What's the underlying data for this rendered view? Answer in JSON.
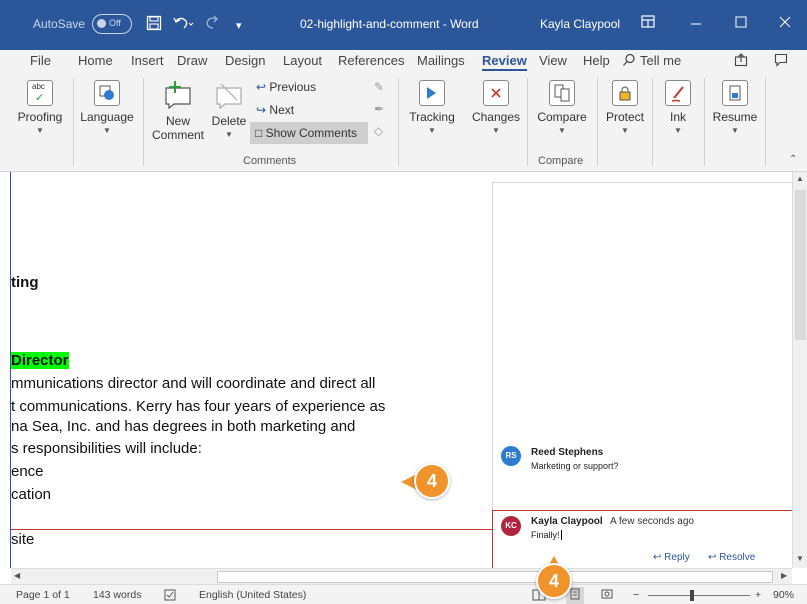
{
  "titlebar": {
    "autosave_label": "AutoSave",
    "autosave_state": "Off",
    "document_title": "02-highlight-and-comment - Word",
    "user_name": "Kayla Claypool",
    "quick_access_icons": [
      "save-icon",
      "undo-icon",
      "redo-icon",
      "customize-icon"
    ],
    "window_controls": [
      "ribbon-display-icon",
      "minimize-icon",
      "maximize-icon",
      "close-icon"
    ]
  },
  "tabs": {
    "items": [
      {
        "label": "File"
      },
      {
        "label": "Home"
      },
      {
        "label": "Insert"
      },
      {
        "label": "Draw"
      },
      {
        "label": "Design"
      },
      {
        "label": "Layout"
      },
      {
        "label": "References"
      },
      {
        "label": "Mailings"
      },
      {
        "label": "Review",
        "active": true
      },
      {
        "label": "View"
      },
      {
        "label": "Help"
      }
    ],
    "tell_me": "Tell me"
  },
  "ribbon": {
    "proofing": "Proofing",
    "language": "Language",
    "new_comment_line1": "New",
    "new_comment_line2": "Comment",
    "delete": "Delete",
    "previous": "Previous",
    "next": "Next",
    "show_comments": "Show Comments",
    "comments_group": "Comments",
    "tracking": "Tracking",
    "changes": "Changes",
    "compare": "Compare",
    "compare_group": "Compare",
    "protect": "Protect",
    "ink": "Ink",
    "resume": "Resume"
  },
  "document": {
    "lines": [
      {
        "text": "ting",
        "bold": true
      },
      {
        "text": "Director",
        "bold": true,
        "highlight": true
      },
      {
        "text": "mmunications director and will coordinate and direct all"
      },
      {
        "text": "t communications. Kerry has four years of experience as"
      },
      {
        "text": "na Sea, Inc. and has degrees in both marketing and"
      },
      {
        "text": "s responsibilities will include:"
      },
      {
        "text": "ence"
      },
      {
        "text": "cation"
      },
      {
        "text": "site"
      }
    ],
    "highlight_color": "#00ff00"
  },
  "comments": [
    {
      "initials": "RS",
      "author": "Reed Stephens",
      "time": "",
      "text": "Marketing or support?",
      "avatar_color": "#2e7bcf"
    },
    {
      "initials": "KC",
      "author": "Kayla Claypool",
      "time": "A few seconds ago",
      "text": "Finally!",
      "avatar_color": "#b0243d",
      "active": true
    }
  ],
  "comment_actions": {
    "reply": "Reply",
    "resolve": "Resolve"
  },
  "callouts": [
    "4",
    "4"
  ],
  "statusbar": {
    "page": "Page 1 of 1",
    "words": "143 words",
    "language": "English (United States)",
    "zoom": "90%",
    "zoom_minus": "−",
    "zoom_plus": "+"
  },
  "colors": {
    "word_blue": "#2b579a",
    "callout_orange": "#f0932b",
    "comment_red": "#c0392b"
  }
}
